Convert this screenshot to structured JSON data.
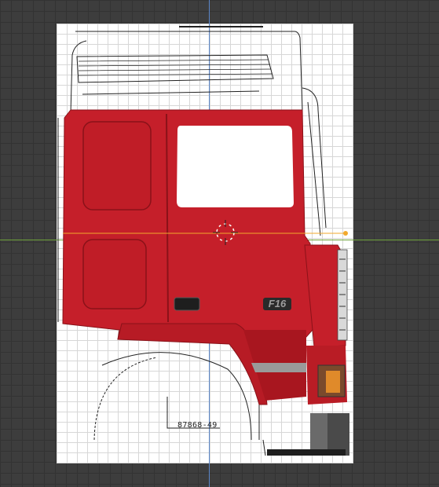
{
  "viewport": {
    "background": "#3d3d3d",
    "axis_y_color": "#5b86c8",
    "axis_x_color": "#6ea33a",
    "selection_color": "#f2a92c"
  },
  "model": {
    "body_color": "#c51f2a",
    "badge_text": "F16",
    "part_number": "87868-49"
  },
  "cursor": {
    "icon": "3d-cursor-icon"
  }
}
